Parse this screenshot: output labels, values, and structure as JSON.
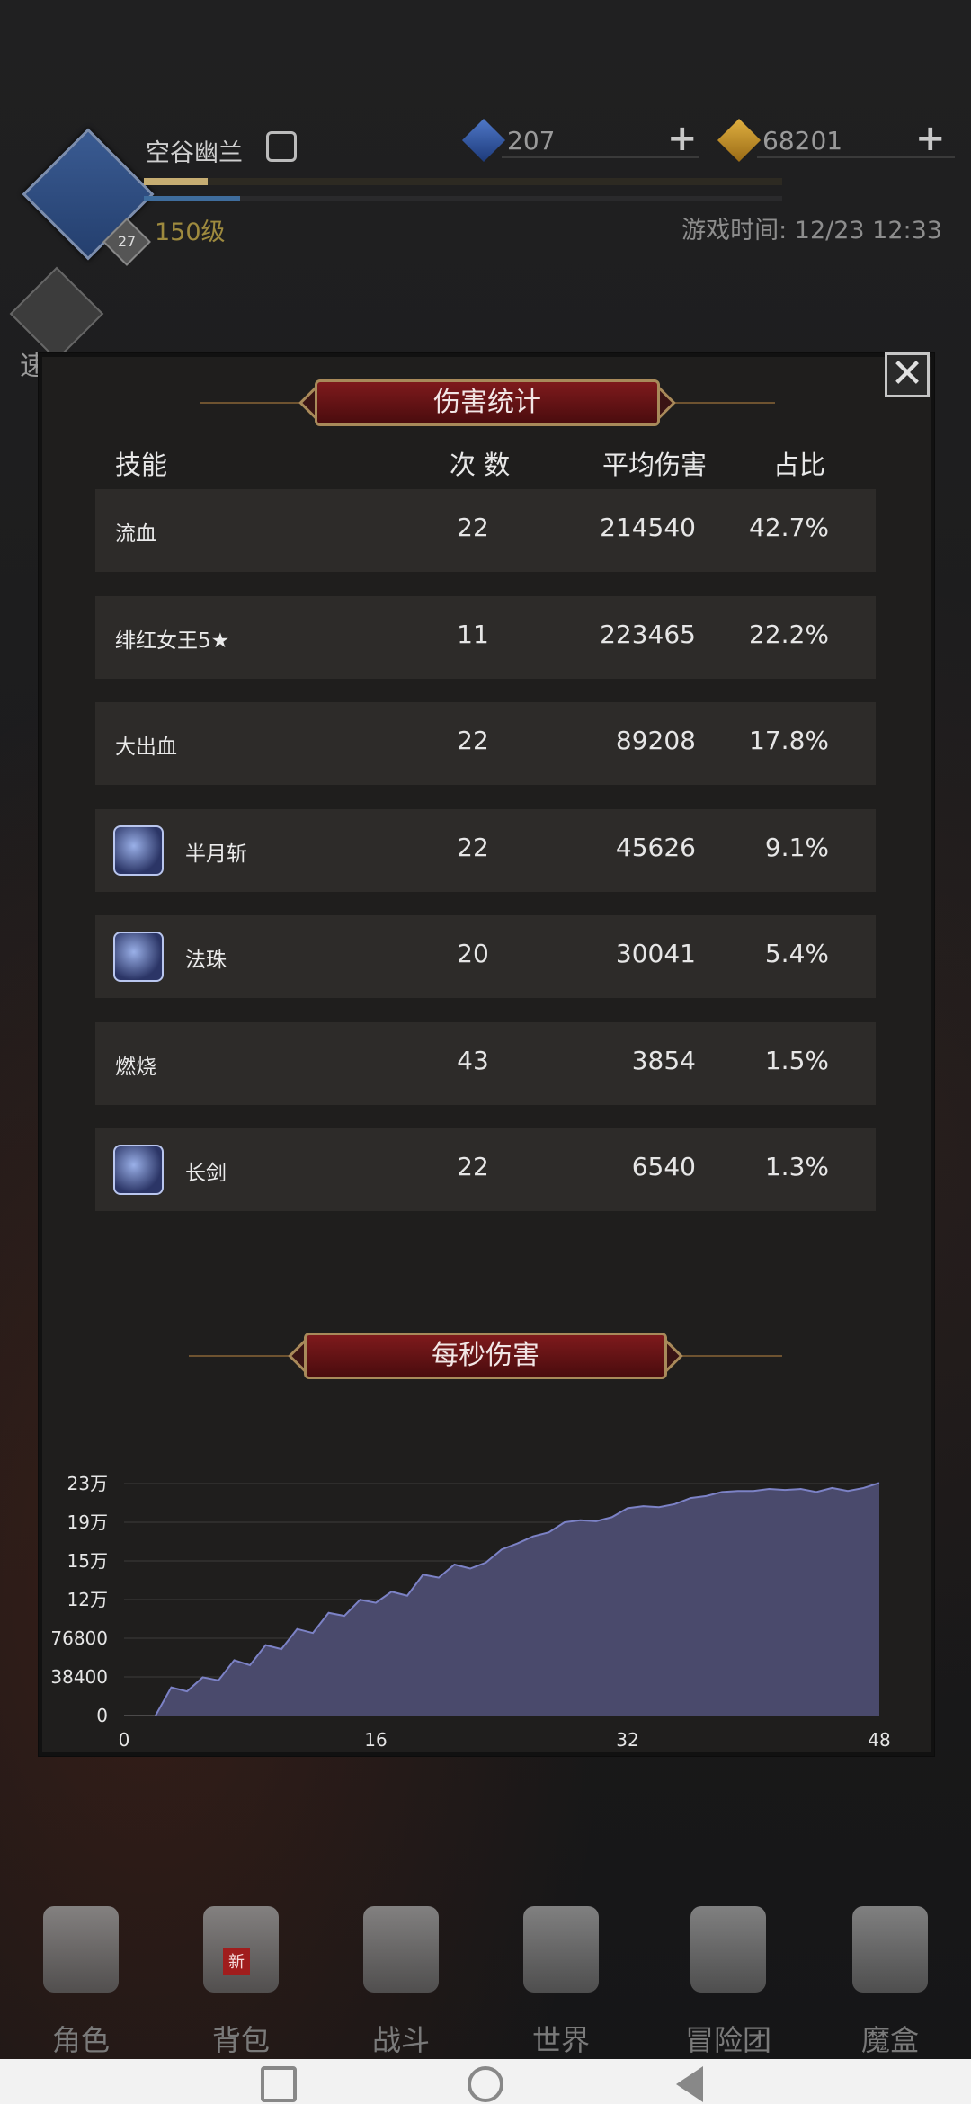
{
  "player": {
    "name": "空谷幽兰",
    "level": "150级",
    "avatar_badge": "27",
    "exp_fraction": 0.1,
    "mp_fraction": 0.15
  },
  "resources": [
    {
      "icon": "blue-gem-icon",
      "value": "207"
    },
    {
      "icon": "gold-gem-icon",
      "value": "68201"
    }
  ],
  "game_time": "游戏时间: 12/23 12:33",
  "sweep_label": "速战",
  "damage_stats": {
    "title": "伤害统计",
    "headers": {
      "skill": "技能",
      "count": "次 数",
      "avg": "平均伤害",
      "share": "占比"
    },
    "rows": [
      {
        "skill": "流血",
        "count": "22",
        "avg": "214540",
        "share": "42.7%",
        "icon": ""
      },
      {
        "skill": "绯红女王5★",
        "count": "11",
        "avg": "223465",
        "share": "22.2%",
        "icon": ""
      },
      {
        "skill": "大出血",
        "count": "22",
        "avg": "89208",
        "share": "17.8%",
        "icon": ""
      },
      {
        "skill": "半月斩",
        "count": "22",
        "avg": "45626",
        "share": "9.1%",
        "icon": "crescent-icon"
      },
      {
        "skill": "法珠",
        "count": "20",
        "avg": "30041",
        "share": "5.4%",
        "icon": "orb-icon"
      },
      {
        "skill": "燃烧",
        "count": "43",
        "avg": "3854",
        "share": "1.5%",
        "icon": ""
      },
      {
        "skill": "长剑",
        "count": "22",
        "avg": "6540",
        "share": "1.3%",
        "icon": "sword-icon"
      }
    ]
  },
  "dps_title": "每秒伤害",
  "chart_data": {
    "type": "area",
    "x": [
      0,
      1,
      2,
      3,
      4,
      5,
      6,
      7,
      8,
      9,
      10,
      11,
      12,
      13,
      14,
      15,
      16,
      17,
      18,
      19,
      20,
      21,
      22,
      23,
      24,
      25,
      26,
      27,
      28,
      29,
      30,
      31,
      32,
      33,
      34,
      35,
      36,
      37,
      38,
      39,
      40,
      41,
      42,
      43,
      44,
      45,
      46,
      47,
      48
    ],
    "series": [
      {
        "values": [
          null,
          null,
          0,
          28000,
          24000,
          38000,
          35000,
          55000,
          50000,
          70000,
          66000,
          86000,
          82000,
          102000,
          99000,
          115000,
          112000,
          123000,
          119000,
          140000,
          137000,
          150000,
          146000,
          152000,
          165000,
          171000,
          178000,
          182000,
          192000,
          194000,
          193000,
          197000,
          206000,
          208000,
          207000,
          210000,
          216000,
          218000,
          222000,
          223000,
          223000,
          225000,
          224000,
          225000,
          222000,
          226000,
          223000,
          226000,
          231000
        ]
      }
    ],
    "yticks": [
      "0",
      "38400",
      "76800",
      "12万",
      "15万",
      "19万",
      "23万"
    ],
    "xticks": [
      "0",
      "16",
      "32",
      "48"
    ],
    "ylim": [
      0,
      230400
    ],
    "xlim": [
      0,
      48
    ],
    "fill_color": "#4a4a6c",
    "line_color": "#7c82c6"
  },
  "nav": [
    {
      "label": "角色",
      "icon": "helmet-icon"
    },
    {
      "label": "背包",
      "icon": "backpack-icon",
      "badge": "新"
    },
    {
      "label": "战斗",
      "icon": "shield-swords-icon"
    },
    {
      "label": "世界",
      "icon": "map-scroll-icon"
    },
    {
      "label": "冒险团",
      "icon": "castle-icon"
    },
    {
      "label": "魔盒",
      "icon": "magic-cube-icon"
    }
  ]
}
